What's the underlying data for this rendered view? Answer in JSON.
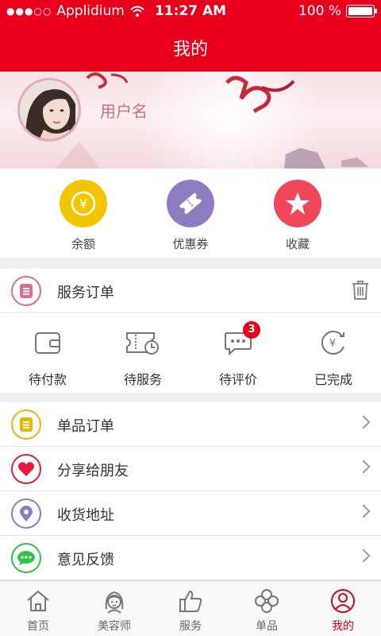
{
  "status": {
    "carrier": "Applidium",
    "time": "11:27 AM",
    "battery": "100 %"
  },
  "header": {
    "title": "我的"
  },
  "profile": {
    "username": "用户名"
  },
  "wallet": [
    {
      "label": "余额",
      "icon": "yuan-coin-icon",
      "color": "#f3c400"
    },
    {
      "label": "优惠券",
      "icon": "coupon-icon",
      "color": "#8f7cc0"
    },
    {
      "label": "收藏",
      "icon": "star-icon",
      "color": "#f0475a"
    }
  ],
  "service_orders": {
    "title": "服务订单",
    "items": [
      {
        "label": "待付款",
        "icon": "wallet-icon"
      },
      {
        "label": "待服务",
        "icon": "ticket-clock-icon"
      },
      {
        "label": "待评价",
        "icon": "comment-icon",
        "badge": "3"
      },
      {
        "label": "已完成",
        "icon": "yuan-refresh-icon"
      }
    ]
  },
  "menu": [
    {
      "label": "单品订单",
      "icon": "list-icon",
      "color": "#e8b800"
    },
    {
      "label": "分享给朋友",
      "icon": "heart-icon",
      "color": "#e21a3a"
    },
    {
      "label": "收货地址",
      "icon": "location-icon",
      "color": "#8f7cc0"
    },
    {
      "label": "意见反馈",
      "icon": "chat-icon",
      "color": "#2ec24a"
    }
  ],
  "tabs": [
    {
      "label": "首页",
      "icon": "home-icon"
    },
    {
      "label": "美容师",
      "icon": "beautician-icon"
    },
    {
      "label": "服务",
      "icon": "thumbs-up-icon"
    },
    {
      "label": "单品",
      "icon": "flower-icon"
    },
    {
      "label": "我的",
      "icon": "profile-icon",
      "active": true
    }
  ],
  "colors": {
    "brand": "#e8001c",
    "pink": "#e06a8a"
  }
}
